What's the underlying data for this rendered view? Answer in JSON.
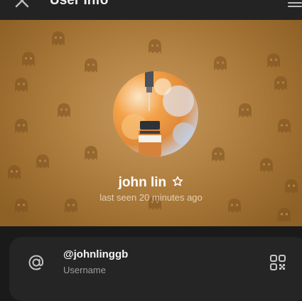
{
  "header": {
    "title": "User Info",
    "close_icon": "close-icon",
    "edit_icon": "edit-icon"
  },
  "profile": {
    "name": "john lin",
    "status_icon": "star-icon",
    "last_seen": "last seen 20 minutes ago",
    "pattern_icon": "ghost-icon",
    "colors": {
      "background_light": "#c79a60",
      "background_dark": "#8e6126",
      "pattern": "#7d5220"
    }
  },
  "username_card": {
    "icon": "at-icon",
    "value": "@johnlinggb",
    "caption": "Username",
    "action_icon": "qr-code-icon"
  }
}
